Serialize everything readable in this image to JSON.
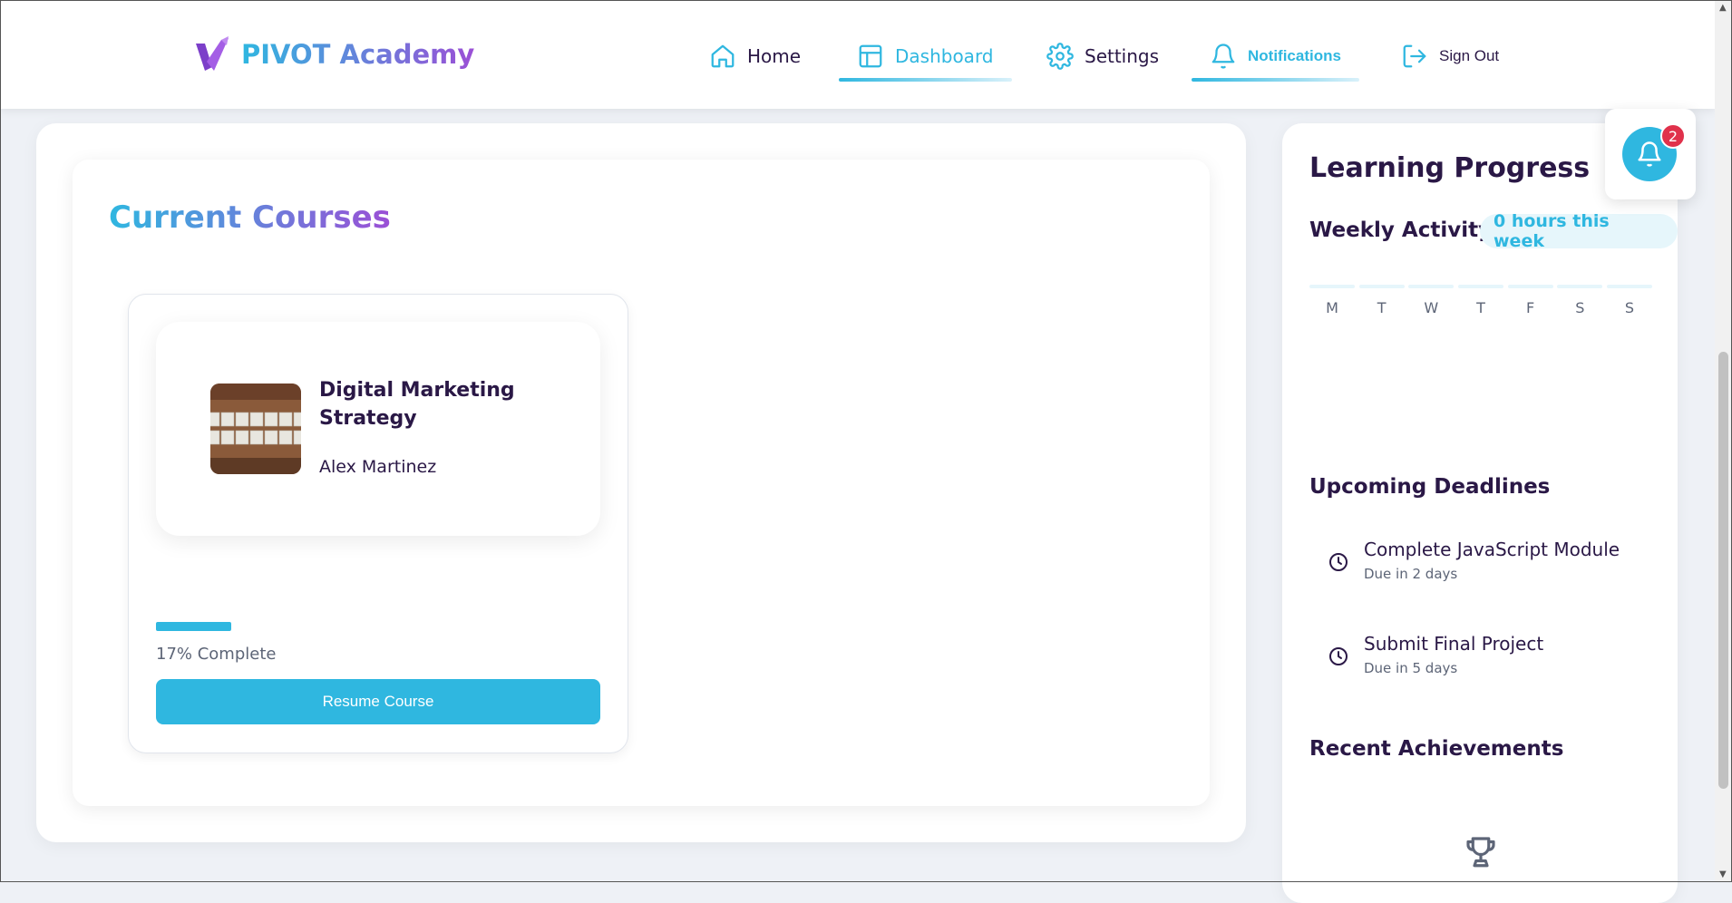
{
  "brand": {
    "name": "PIVOT Academy",
    "logo_icon": "v-logo-icon"
  },
  "nav": {
    "home": "Home",
    "dashboard": "Dashboard",
    "settings": "Settings",
    "notifications": "Notifications",
    "sign_out": "Sign Out",
    "active": "Dashboard"
  },
  "main": {
    "title": "Current Courses",
    "course": {
      "name": "Digital Marketing Strategy",
      "instructor": "Alex Martinez",
      "progress_percent": 17,
      "progress_label": "17% Complete",
      "button": "Resume Course"
    }
  },
  "side": {
    "title": "Learning Progress",
    "weekly_title": "Weekly Activity",
    "hours_badge": "0 hours this week",
    "days": [
      "M",
      "T",
      "W",
      "T",
      "F",
      "S",
      "S"
    ],
    "deadlines_title": "Upcoming Deadlines",
    "deadlines": [
      {
        "name": "Complete JavaScript Module",
        "due": "Due in 2 days"
      },
      {
        "name": "Submit Final Project",
        "due": "Due in 5 days"
      }
    ],
    "achievements_title": "Recent Achievements"
  },
  "floating": {
    "badge_count": "2"
  },
  "colors": {
    "accent": "#2fb7e0",
    "purple": "#9b4fd6",
    "text": "#2a1846",
    "badge": "#e0314b"
  }
}
